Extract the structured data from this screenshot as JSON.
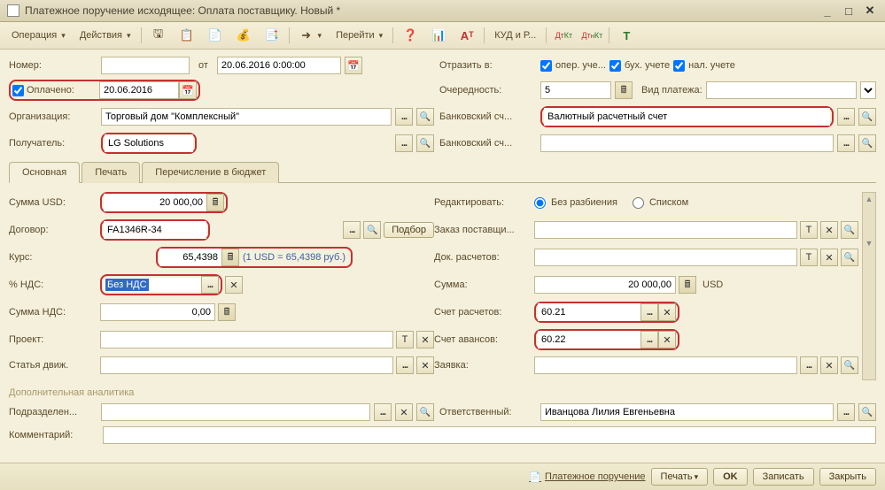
{
  "title": "Платежное поручение исходящее: Оплата поставщику. Новый *",
  "toolbar": {
    "operation": "Операция",
    "actions": "Действия",
    "goto": "Перейти",
    "kudir": "КУД и Р..."
  },
  "header": {
    "number_label": "Номер:",
    "from_label": "от",
    "date_from": "20.06.2016 0:00:00",
    "reflect_label": "Отразить в:",
    "reflect_oper": "опер. уче...",
    "reflect_buh": "бух. учете",
    "reflect_nal": "нал. учете",
    "paid_label": "Оплачено:",
    "paid_date": "20.06.2016",
    "priority_label": "Очередность:",
    "priority_value": "5",
    "payment_type_label": "Вид платежа:",
    "org_label": "Организация:",
    "org_value": "Торговый дом \"Комплексный\"",
    "bank_acc1_label": "Банковский сч...",
    "bank_acc1_value": "Валютный расчетный счет",
    "recipient_label": "Получатель:",
    "recipient_value": "LG Solutions",
    "bank_acc2_label": "Банковский сч..."
  },
  "tabs": {
    "main": "Основная",
    "print": "Печать",
    "budget": "Перечисление в бюджет"
  },
  "main": {
    "sum_usd_label": "Сумма USD:",
    "sum_usd": "20 000,00",
    "edit_label": "Редактировать:",
    "radio1": "Без разбиения",
    "radio2": "Списком",
    "contract_label": "Договор:",
    "contract_value": "FA1346R-34",
    "select_btn": "Подбор",
    "order_label": "Заказ поставщи...",
    "rate_label": "Курс:",
    "rate_value": "65,4398",
    "rate_hint": "(1 USD = 65,4398 руб.)",
    "docr_label": "Док. расчетов:",
    "vat_pct_label": "% НДС:",
    "vat_pct_value": "Без НДС",
    "sum_label": "Сумма:",
    "sum_value": "20 000,00",
    "sum_currency": "USD",
    "vat_sum_label": "Сумма НДС:",
    "vat_sum_value": "0,00",
    "acc_settle_label": "Счет расчетов:",
    "acc_settle_value": "60.21",
    "project_label": "Проект:",
    "acc_advance_label": "Счет авансов:",
    "acc_advance_value": "60.22",
    "article_label": "Статья движ.",
    "request_label": "Заявка:"
  },
  "analytics_label": "Дополнительная аналитика",
  "footer_fields": {
    "subdiv_label": "Подразделен...",
    "responsible_label": "Ответственный:",
    "responsible_value": "Иванцова Лилия Евгеньевна",
    "comment_label": "Комментарий:"
  },
  "footer": {
    "link": "Платежное поручение",
    "print": "Печать",
    "ok": "OK",
    "save": "Записать",
    "close": "Закрыть"
  }
}
